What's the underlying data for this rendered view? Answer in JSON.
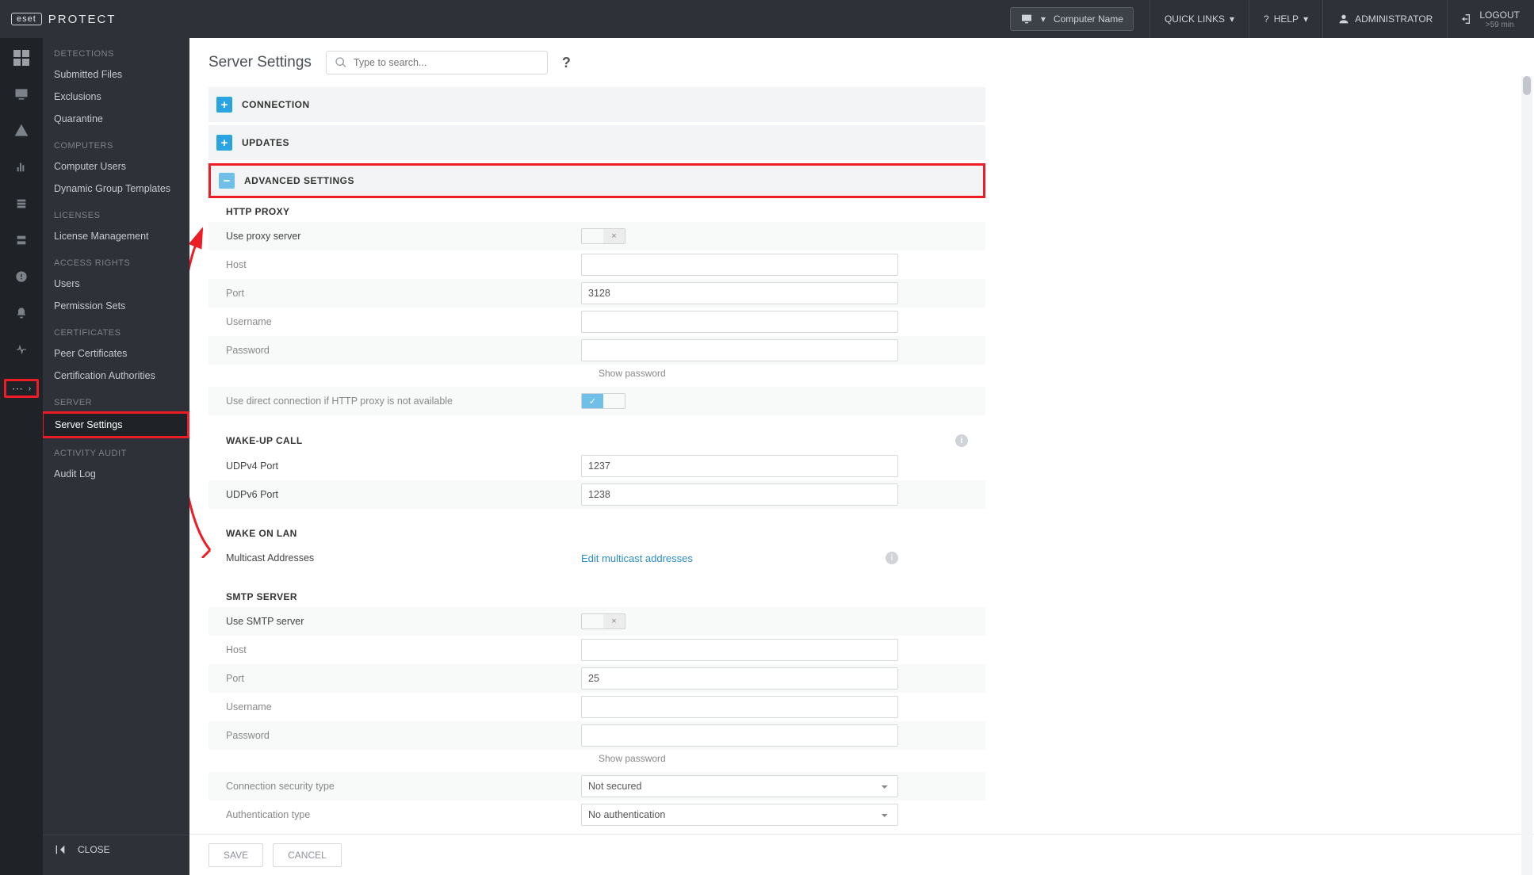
{
  "topbar": {
    "brand_eset": "eset",
    "brand_protect": "PROTECT",
    "computer_name": "Computer Name",
    "quick_links": "QUICK LINKS",
    "help": "HELP",
    "admin": "ADMINISTRATOR",
    "logout": "LOGOUT",
    "logout_sub": ">59 min"
  },
  "sidenav": {
    "groups": {
      "detections": {
        "h": "DETECTIONS",
        "items": [
          "Submitted Files",
          "Exclusions",
          "Quarantine"
        ]
      },
      "computers": {
        "h": "COMPUTERS",
        "items": [
          "Computer Users",
          "Dynamic Group Templates"
        ]
      },
      "licenses": {
        "h": "LICENSES",
        "items": [
          "License Management"
        ]
      },
      "access": {
        "h": "ACCESS RIGHTS",
        "items": [
          "Users",
          "Permission Sets"
        ]
      },
      "certs": {
        "h": "CERTIFICATES",
        "items": [
          "Peer Certificates",
          "Certification Authorities"
        ]
      },
      "server": {
        "h": "SERVER",
        "items": [
          "Server Settings"
        ]
      },
      "audit": {
        "h": "ACTIVITY AUDIT",
        "items": [
          "Audit Log"
        ]
      }
    },
    "close": "CLOSE"
  },
  "page": {
    "title": "Server Settings",
    "search_placeholder": "Type to search...",
    "sections": {
      "connection": "CONNECTION",
      "updates": "UPDATES",
      "advanced": "ADVANCED SETTINGS"
    }
  },
  "advanced": {
    "http_proxy": {
      "h": "HTTP PROXY",
      "use_proxy": "Use proxy server",
      "host": "Host",
      "port": "Port",
      "port_val": "3128",
      "username": "Username",
      "password": "Password",
      "show_pw": "Show password",
      "direct": "Use direct connection if HTTP proxy is not available"
    },
    "wakeup": {
      "h": "WAKE-UP CALL",
      "udp4": "UDPv4 Port",
      "udp4_val": "1237",
      "udp6": "UDPv6 Port",
      "udp6_val": "1238"
    },
    "wol": {
      "h": "WAKE ON LAN",
      "multi": "Multicast Addresses",
      "edit_link": "Edit multicast addresses"
    },
    "smtp": {
      "h": "SMTP SERVER",
      "use": "Use SMTP server",
      "host": "Host",
      "port": "Port",
      "port_val": "25",
      "username": "Username",
      "password": "Password",
      "show_pw": "Show password",
      "conn_sec": "Connection security type",
      "conn_sec_val": "Not secured",
      "auth_type": "Authentication type",
      "auth_type_val": "No authentication"
    }
  },
  "footer": {
    "save": "SAVE",
    "cancel": "CANCEL"
  }
}
